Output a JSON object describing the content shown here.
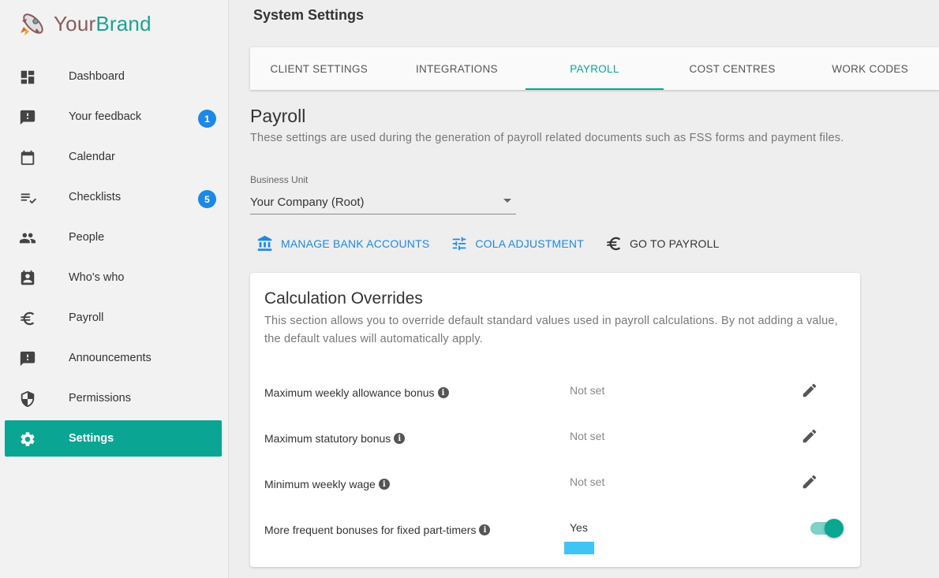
{
  "brand": {
    "part1": "Your",
    "part2": "Brand"
  },
  "sidebar": {
    "items": [
      {
        "label": "Dashboard",
        "icon": "dashboard-icon"
      },
      {
        "label": "Your feedback",
        "icon": "feedback-icon",
        "badge": "1"
      },
      {
        "label": "Calendar",
        "icon": "calendar-icon"
      },
      {
        "label": "Checklists",
        "icon": "checklist-icon",
        "badge": "5"
      },
      {
        "label": "People",
        "icon": "people-icon"
      },
      {
        "label": "Who's who",
        "icon": "contact-icon"
      },
      {
        "label": "Payroll",
        "icon": "euro-icon"
      },
      {
        "label": "Announcements",
        "icon": "announcement-icon"
      },
      {
        "label": "Permissions",
        "icon": "shield-icon"
      },
      {
        "label": "Settings",
        "icon": "gear-icon",
        "active": true
      }
    ]
  },
  "header": {
    "title": "System Settings"
  },
  "tabs": [
    {
      "label": "CLIENT SETTINGS"
    },
    {
      "label": "INTEGRATIONS"
    },
    {
      "label": "PAYROLL",
      "active": true
    },
    {
      "label": "COST CENTRES"
    },
    {
      "label": "WORK CODES"
    }
  ],
  "payroll": {
    "title": "Payroll",
    "description": "These settings are used during the generation of payroll related documents such as FSS forms and payment files.",
    "business_unit_label": "Business Unit",
    "business_unit_value": "Your Company (Root)",
    "actions": {
      "manage_bank": "MANAGE BANK ACCOUNTS",
      "cola": "COLA ADJUSTMENT",
      "go_payroll": "GO TO PAYROLL"
    }
  },
  "overrides": {
    "title": "Calculation Overrides",
    "description": "This section allows you to override default standard values used in payroll calculations. By not adding a value, the default values will automatically apply.",
    "rows": [
      {
        "label": "Maximum weekly allowance bonus",
        "value": "Not set"
      },
      {
        "label": "Maximum statutory bonus",
        "value": "Not set"
      },
      {
        "label": "Minimum weekly wage",
        "value": "Not set"
      },
      {
        "label": "More frequent bonuses for fixed part-timers",
        "value": "Yes"
      }
    ]
  },
  "colors": {
    "accent": "#0aa593",
    "link": "#1e88e5",
    "badge": "#1e88e5"
  }
}
